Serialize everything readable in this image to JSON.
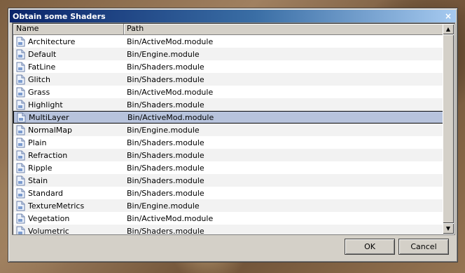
{
  "dialog": {
    "title": "Obtain some Shaders",
    "close_glyph": "×"
  },
  "columns": {
    "name": "Name",
    "path": "Path"
  },
  "selected_index": 6,
  "rows": [
    {
      "name": "Architecture",
      "path": "Bin/ActiveMod.module"
    },
    {
      "name": "Default",
      "path": "Bin/Engine.module"
    },
    {
      "name": "FatLine",
      "path": "Bin/Shaders.module"
    },
    {
      "name": "Glitch",
      "path": "Bin/Shaders.module"
    },
    {
      "name": "Grass",
      "path": "Bin/ActiveMod.module"
    },
    {
      "name": "Highlight",
      "path": "Bin/Shaders.module"
    },
    {
      "name": "MultiLayer",
      "path": "Bin/ActiveMod.module"
    },
    {
      "name": "NormalMap",
      "path": "Bin/Engine.module"
    },
    {
      "name": "Plain",
      "path": "Bin/Shaders.module"
    },
    {
      "name": "Refraction",
      "path": "Bin/Shaders.module"
    },
    {
      "name": "Ripple",
      "path": "Bin/Shaders.module"
    },
    {
      "name": "Stain",
      "path": "Bin/Shaders.module"
    },
    {
      "name": "Standard",
      "path": "Bin/Shaders.module"
    },
    {
      "name": "TextureMetrics",
      "path": "Bin/Engine.module"
    },
    {
      "name": "Vegetation",
      "path": "Bin/ActiveMod.module"
    },
    {
      "name": "Volumetric",
      "path": "Bin/Shaders.module"
    }
  ],
  "scrollbar": {
    "up_glyph": "▲",
    "down_glyph": "▼"
  },
  "buttons": {
    "ok": "OK",
    "cancel": "Cancel"
  }
}
